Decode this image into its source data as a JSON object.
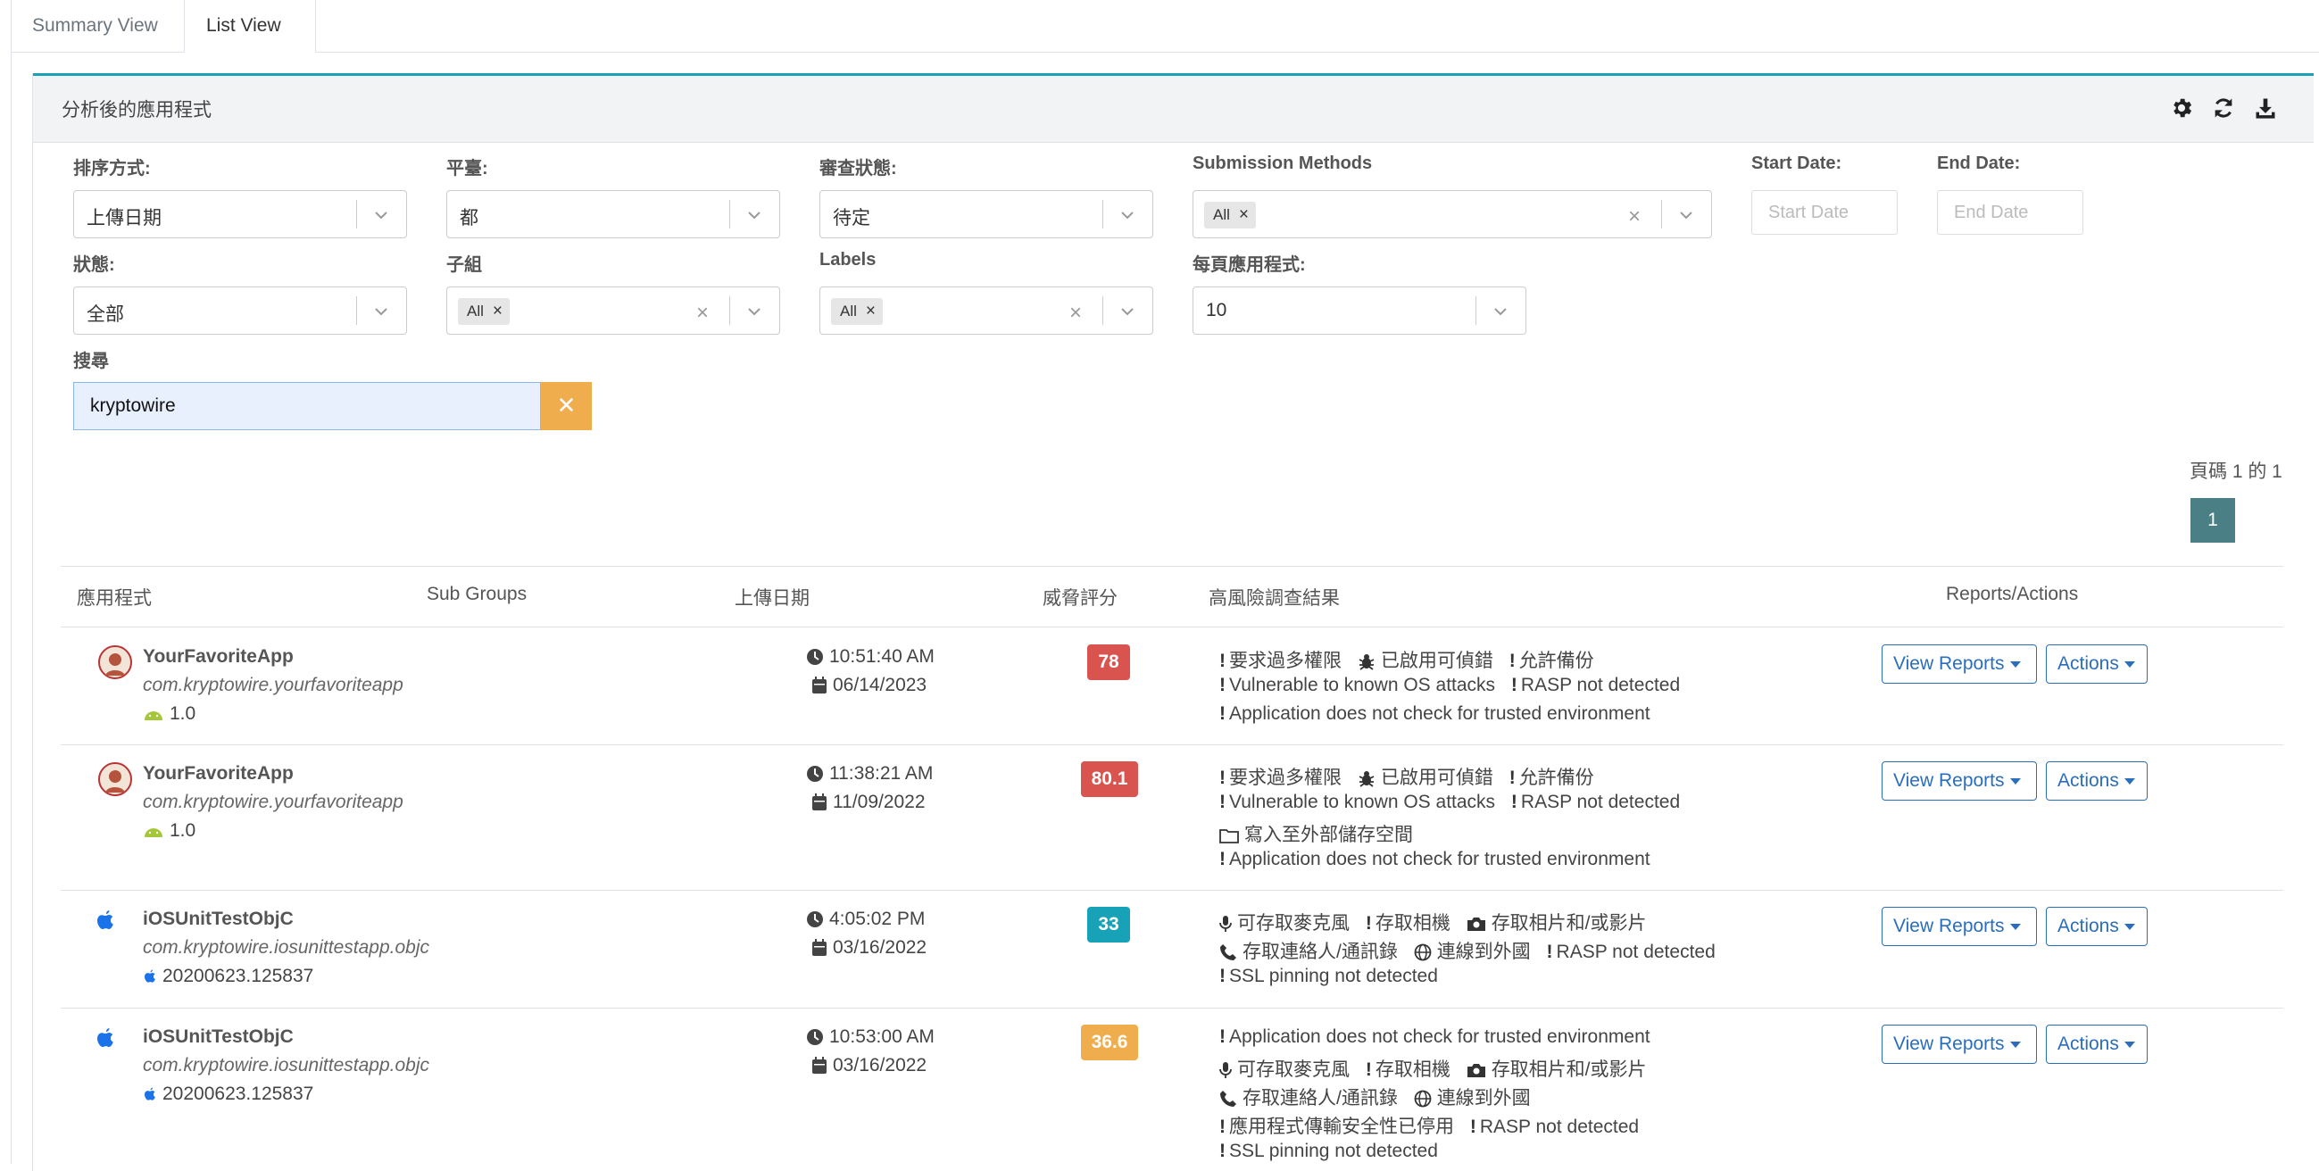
{
  "tabs": {
    "summary": "Summary View",
    "list": "List View"
  },
  "card": {
    "title": "分析後的應用程式"
  },
  "filters": {
    "sort": {
      "label": "排序方式:",
      "value": "上傳日期"
    },
    "platform": {
      "label": "平臺:",
      "value": "都"
    },
    "review": {
      "label": "審查狀態:",
      "value": "待定"
    },
    "submission": {
      "label": "Submission Methods",
      "chip": "All"
    },
    "start_date": {
      "label": "Start Date:",
      "placeholder": "Start Date"
    },
    "end_date": {
      "label": "End Date:",
      "placeholder": "End Date"
    },
    "status": {
      "label": "狀態:",
      "value": "全部"
    },
    "subgroup": {
      "label": "子組",
      "chip": "All"
    },
    "labels": {
      "label": "Labels",
      "chip": "All"
    },
    "per_page": {
      "label": "每頁應用程式:",
      "value": "10"
    },
    "search": {
      "label": "搜尋",
      "value": "kryptowire"
    }
  },
  "pager": {
    "text": "頁碼 1 的 1",
    "current": "1"
  },
  "table": {
    "headers": {
      "app": "應用程式",
      "subgroups": "Sub Groups",
      "upload": "上傳日期",
      "score": "威脅評分",
      "findings": "高風險調查結果",
      "actions": "Reports/Actions"
    },
    "view_reports": "View Reports",
    "actions": "Actions",
    "rows": [
      {
        "name": "YourFavoriteApp",
        "pkg": "com.kryptowire.yourfavoriteapp",
        "version": "1.0",
        "time": "10:51:40 AM",
        "date": "06/14/2023",
        "score": "78",
        "score_color": "#d9534f",
        "f": [
          "要求過多權限",
          "已啟用可偵錯",
          "允許備份",
          "Vulnerable to known OS attacks",
          "RASP not detected",
          "Application does not check for trusted environment"
        ]
      },
      {
        "name": "YourFavoriteApp",
        "pkg": "com.kryptowire.yourfavoriteapp",
        "version": "1.0",
        "time": "11:38:21 AM",
        "date": "11/09/2022",
        "score": "80.1",
        "score_color": "#d9534f",
        "f": [
          "要求過多權限",
          "已啟用可偵錯",
          "允許備份",
          "Vulnerable to known OS attacks",
          "RASP not detected",
          "寫入至外部儲存空間",
          "Application does not check for trusted environment"
        ]
      },
      {
        "name": "iOSUnitTestObjC",
        "pkg": "com.kryptowire.iosunittestapp.objc",
        "version": "20200623.125837",
        "time": "4:05:02 PM",
        "date": "03/16/2022",
        "score": "33",
        "score_color": "#17a2b8",
        "f": [
          "可存取麥克風",
          "存取相機",
          "存取相片和/或影片",
          "存取連絡人/通訊錄",
          "連線到外國",
          "RASP not detected",
          "SSL pinning not detected"
        ]
      },
      {
        "name": "iOSUnitTestObjC",
        "pkg": "com.kryptowire.iosunittestapp.objc",
        "version": "20200623.125837",
        "time": "10:53:00 AM",
        "date": "03/16/2022",
        "score": "36.6",
        "score_color": "#f0ad4e",
        "f": [
          "Application does not check for trusted environment",
          "可存取麥克風",
          "存取相機",
          "存取相片和/或影片",
          "存取連絡人/通訊錄",
          "連線到外國",
          "應用程式傳輸安全性已停用",
          "RASP not detected",
          "SSL pinning not detected"
        ]
      }
    ]
  },
  "icons": {
    "settings": "gear-icon",
    "refresh": "refresh-icon",
    "download": "download-icon"
  }
}
